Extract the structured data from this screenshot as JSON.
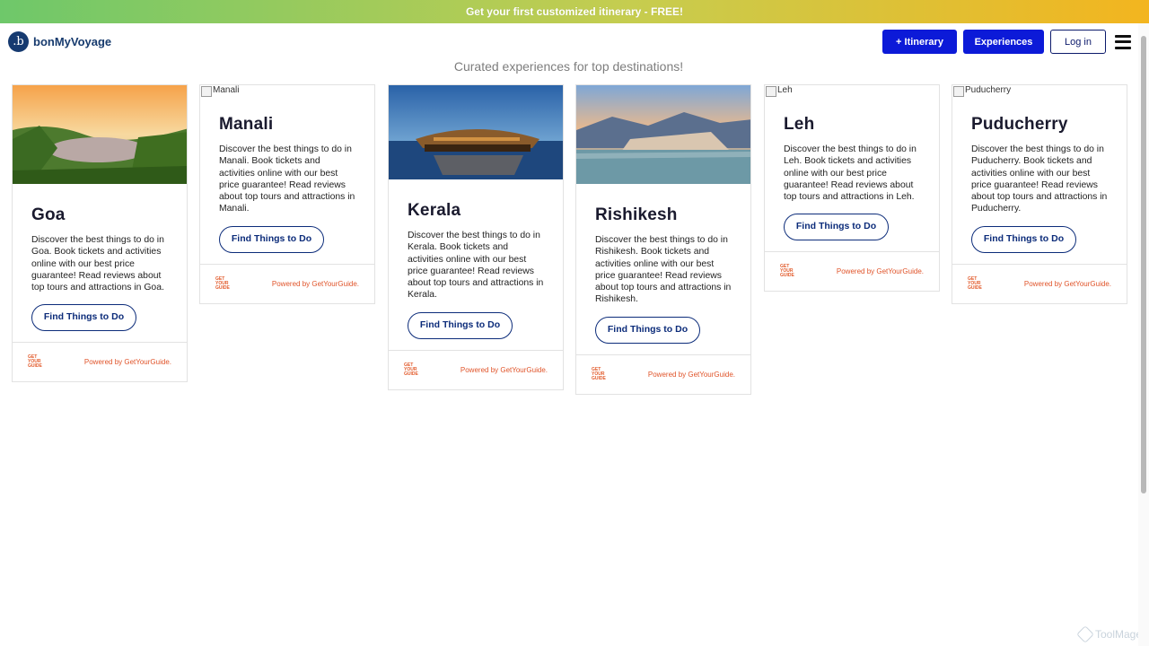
{
  "promo": {
    "text": "Get your first customized itinerary - FREE!"
  },
  "header": {
    "brand_letter": ".b",
    "brand_name": "bonMyVoyage",
    "itinerary_label": "+ Itinerary",
    "experiences_label": "Experiences",
    "login_label": "Log in"
  },
  "subtitle": "Curated experiences for top destinations!",
  "cards": [
    {
      "title": "Goa",
      "desc": "Discover the best things to do in Goa. Book tickets and activities online with our best price guarantee! Read reviews about top tours and attractions in Goa.",
      "button": "Find Things to Do",
      "powered": "Powered by GetYourGuide.",
      "gyg": "GET YOUR GUIDE",
      "image_alt": "Goa"
    },
    {
      "title": "Manali",
      "desc": "Discover the best things to do in Manali. Book tickets and activities online with our best price guarantee! Read reviews about top tours and attractions in Manali.",
      "button": "Find Things to Do",
      "powered": "Powered by GetYourGuide.",
      "gyg": "GET YOUR GUIDE",
      "image_alt": "Manali"
    },
    {
      "title": "Kerala",
      "desc": "Discover the best things to do in Kerala. Book tickets and activities online with our best price guarantee! Read reviews about top tours and attractions in Kerala.",
      "button": "Find Things to Do",
      "powered": "Powered by GetYourGuide.",
      "gyg": "GET YOUR GUIDE",
      "image_alt": "Kerala"
    },
    {
      "title": "Rishikesh",
      "desc": "Discover the best things to do in Rishikesh. Book tickets and activities online with our best price guarantee! Read reviews about top tours and attractions in Rishikesh.",
      "button": "Find Things to Do",
      "powered": "Powered by GetYourGuide.",
      "gyg": "GET YOUR GUIDE",
      "image_alt": "Rishikesh"
    },
    {
      "title": "Leh",
      "desc": "Discover the best things to do in Leh. Book tickets and activities online with our best price guarantee! Read reviews about top tours and attractions in Leh.",
      "button": "Find Things to Do",
      "powered": "Powered by GetYourGuide.",
      "gyg": "GET YOUR GUIDE",
      "image_alt": "Leh"
    },
    {
      "title": "Puducherry",
      "desc": "Discover the best things to do in Puducherry. Book tickets and activities online with our best price guarantee! Read reviews about top tours and attractions in Puducherry.",
      "button": "Find Things to Do",
      "powered": "Powered by GetYourGuide.",
      "gyg": "GET YOUR GUIDE",
      "image_alt": "Puducherry"
    }
  ],
  "watermark": "ToolMage",
  "colors": {
    "brand": "#173b6e",
    "primary_button": "#0c1ad8",
    "powered_text": "#e0542a"
  }
}
